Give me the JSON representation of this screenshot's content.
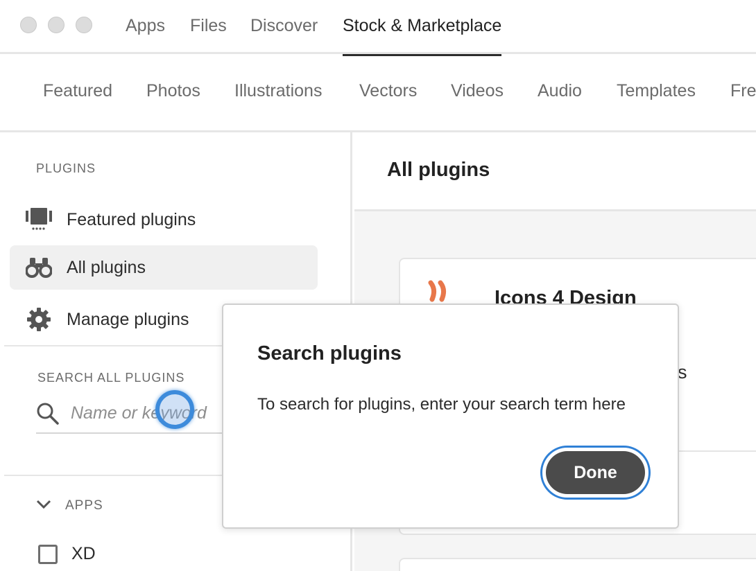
{
  "window": {
    "top_tabs": [
      "Apps",
      "Files",
      "Discover",
      "Stock & Marketplace"
    ],
    "active_top_tab": "Stock & Marketplace"
  },
  "subnav": {
    "tabs": [
      "Featured",
      "Photos",
      "Illustrations",
      "Vectors",
      "Videos",
      "Audio",
      "Templates",
      "Fre"
    ]
  },
  "sidebar": {
    "plugins_heading": "PLUGINS",
    "items": [
      {
        "label": "Featured plugins",
        "icon": "featured-icon",
        "selected": false
      },
      {
        "label": "All plugins",
        "icon": "binoculars-icon",
        "selected": true
      },
      {
        "label": "Manage plugins",
        "icon": "gear-icon",
        "selected": false
      }
    ],
    "search_heading": "SEARCH ALL PLUGINS",
    "search_placeholder": "Name or keyword",
    "apps_heading": "APPS",
    "apps_filters": [
      {
        "label": "XD",
        "checked": false
      }
    ]
  },
  "main": {
    "title": "All plugins",
    "plugin_card": {
      "name": "Icons 4 Design",
      "partial_text": "s"
    }
  },
  "dialog": {
    "title": "Search plugins",
    "body": "To search for plugins, enter your search term here",
    "done_label": "Done"
  },
  "colors": {
    "accent_focus": "#2f80d6",
    "button_dark": "#4b4b4b",
    "logo_orange": "#e8774a",
    "logo_green": "#2f6e57"
  }
}
